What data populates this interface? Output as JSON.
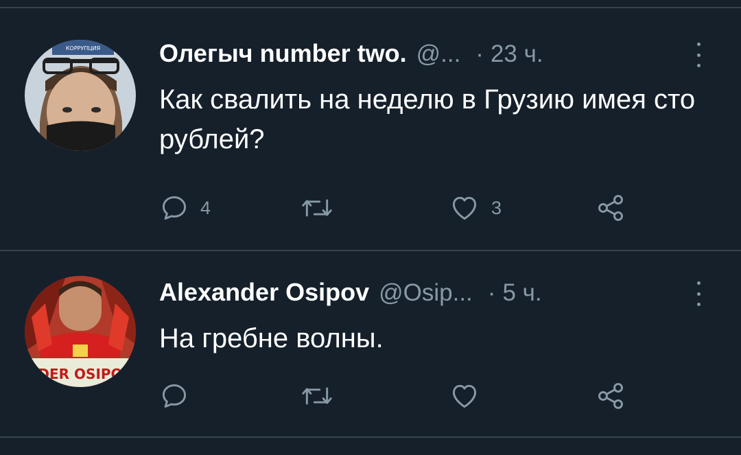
{
  "tweets": [
    {
      "author_name": "Олегыч number two.",
      "handle": "@...",
      "separator": "·",
      "time": "23 ч.",
      "text": "Как свалить на неделю в Грузию имея сто рублей?",
      "reply_count": "4",
      "retweet_count": "",
      "like_count": "3",
      "avatar_badge_text": "КОРРУПЦИЯ"
    },
    {
      "author_name": "Alexander Osipov",
      "handle": "@Osip...",
      "separator": "·",
      "time": "5 ч.",
      "text": "На гребне волны.",
      "reply_count": "",
      "retweet_count": "",
      "like_count": "",
      "avatar_badge_text": "DER OSIPO"
    }
  ],
  "colors": {
    "background": "#15202b",
    "divider": "#38444d",
    "secondary_text": "#8899a6",
    "primary_text": "#ffffff"
  },
  "icons": {
    "reply": "reply-icon",
    "retweet": "retweet-icon",
    "like": "heart-icon",
    "share": "share-icon",
    "more": "more-vertical-icon"
  }
}
